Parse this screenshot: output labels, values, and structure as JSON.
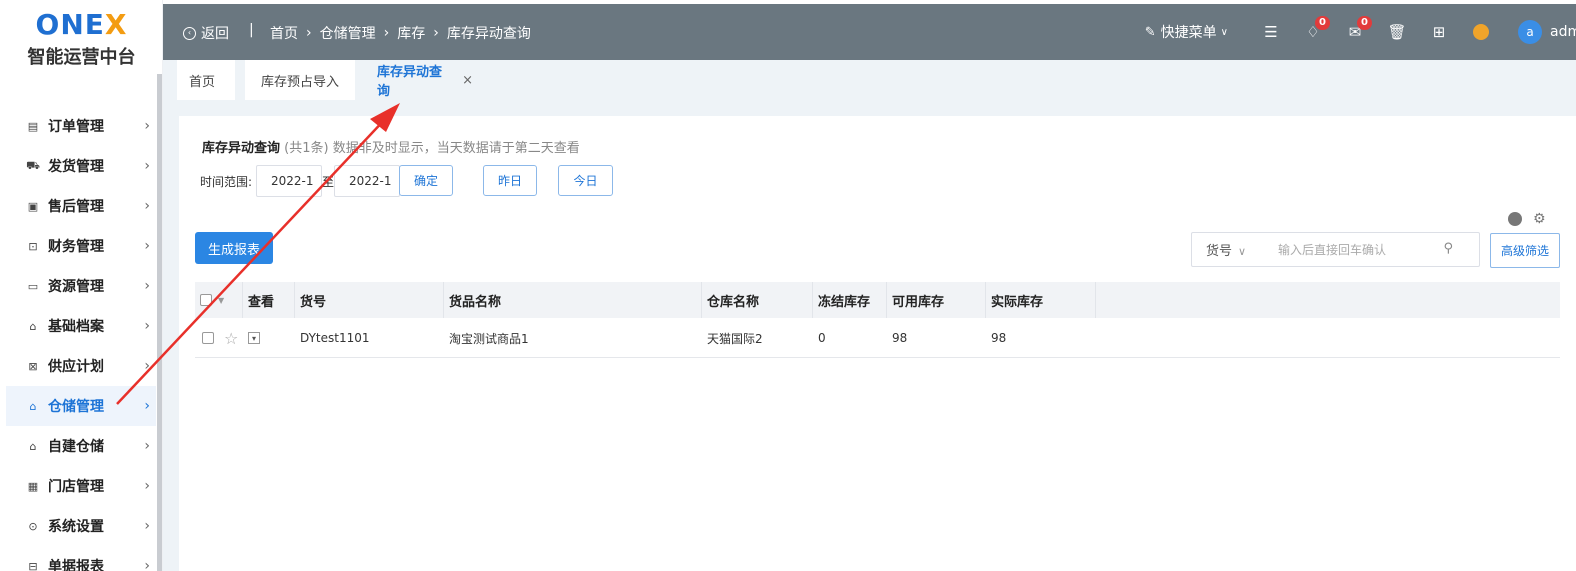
{
  "logo": {
    "mark_a": "ONE",
    "mark_b": "X",
    "subtitle": "智能运营中台"
  },
  "sidebar": {
    "items": [
      {
        "label": "订单管理",
        "icon": "order-icon",
        "active": false
      },
      {
        "label": "发货管理",
        "icon": "truck-icon",
        "active": false
      },
      {
        "label": "售后管理",
        "icon": "aftersale-icon",
        "active": false
      },
      {
        "label": "财务管理",
        "icon": "finance-icon",
        "active": false
      },
      {
        "label": "资源管理",
        "icon": "resource-icon",
        "active": false
      },
      {
        "label": "基础档案",
        "icon": "archive-icon",
        "active": false
      },
      {
        "label": "供应计划",
        "icon": "supply-icon",
        "active": false
      },
      {
        "label": "仓储管理",
        "icon": "warehouse-icon",
        "active": true
      },
      {
        "label": "自建仓储",
        "icon": "home-warehouse-icon",
        "active": false
      },
      {
        "label": "门店管理",
        "icon": "store-icon",
        "active": false
      },
      {
        "label": "系统设置",
        "icon": "settings-icon",
        "active": false
      },
      {
        "label": "单据报表",
        "icon": "report-icon",
        "active": false
      }
    ]
  },
  "header": {
    "back_label": "返回",
    "separator": "|",
    "breadcrumb": [
      "首页",
      "仓储管理",
      "库存",
      "库存异动查询"
    ],
    "quick_menu": "快捷菜单",
    "notify_count": "0",
    "mail_count": "0",
    "avatar_letter": "a",
    "username": "admin"
  },
  "tabs": [
    {
      "label": "首页",
      "active": false
    },
    {
      "label": "库存预占导入",
      "active": false
    },
    {
      "label": "库存异动查询",
      "active": true,
      "closable": true
    }
  ],
  "page": {
    "title": "库存异动查询",
    "note": "(共1条) 数据非及时显示，当天数据请于第二天查看",
    "time_label": "时间范围:",
    "date_from": "2022-1",
    "to_label": "至",
    "date_to": "2022-1",
    "confirm": "确定",
    "yesterday": "昨日",
    "today": "今日",
    "generate_report": "生成报表",
    "search_field": "货号",
    "search_placeholder": "输入后直接回车确认",
    "advanced_filter": "高级筛选"
  },
  "table": {
    "columns": [
      "查看",
      "货号",
      "货品名称",
      "仓库名称",
      "冻结库存",
      "可用库存",
      "实际库存"
    ],
    "rows": [
      {
        "sku": "DYtest1101",
        "name": "淘宝测试商品1",
        "warehouse": "天猫国际2",
        "frozen": "0",
        "available": "98",
        "actual": "98"
      }
    ]
  },
  "colors": {
    "header_bg": "#6a7780",
    "accent": "#1d74d6",
    "primary_button": "#2b86e3",
    "annotation_arrow": "#e8302a"
  }
}
